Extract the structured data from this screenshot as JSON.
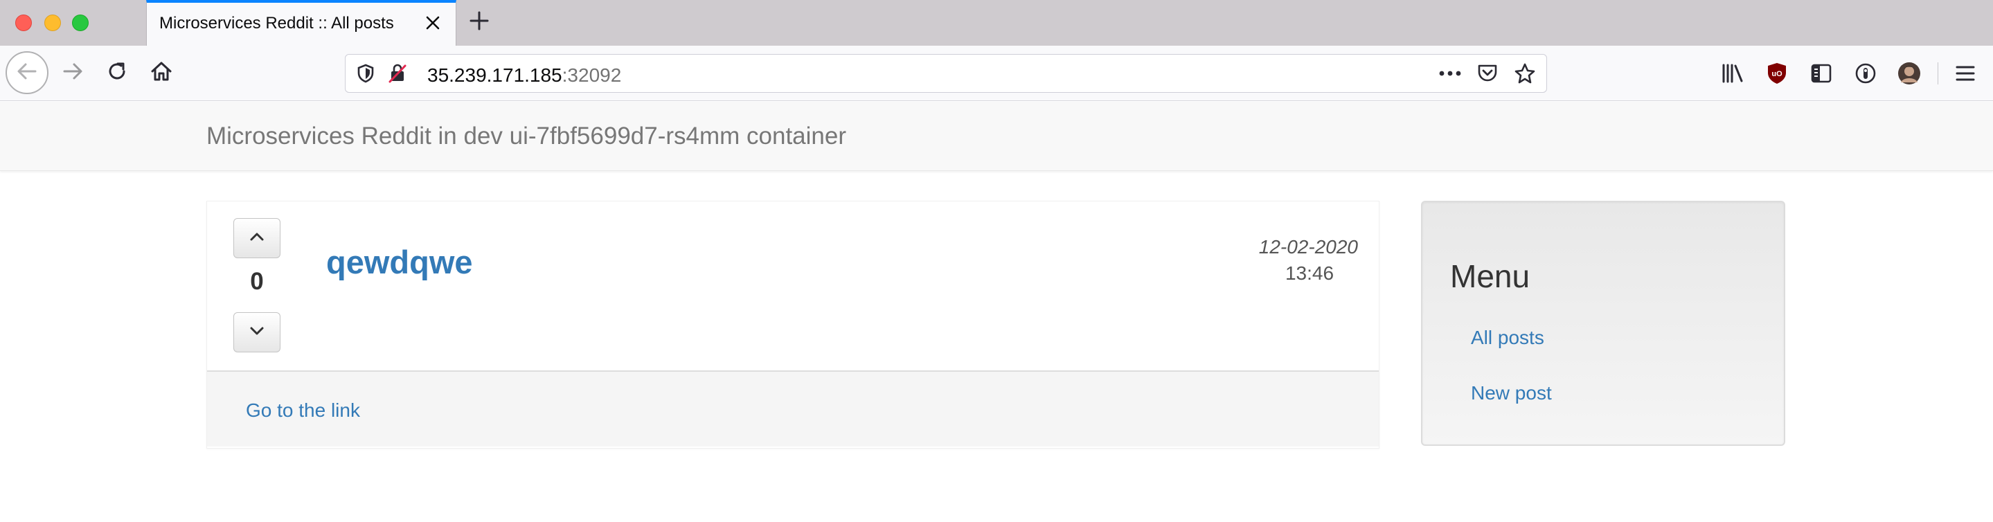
{
  "browser": {
    "tab_title": "Microservices Reddit :: All posts",
    "url_host": "35.239.171.185",
    "url_port": ":32092",
    "icons": {
      "back": "arrow-left-icon",
      "forward": "arrow-right-icon",
      "reload": "reload-icon",
      "home": "home-icon",
      "new_tab": "plus-icon",
      "close_tab": "close-icon",
      "library": "library-icon",
      "ublock": "ublock-origin-icon",
      "sidebar": "sidebar-icon",
      "extension": "extension-icon",
      "menu": "hamburger-menu-icon",
      "page_actions": "more-horizontal-icon",
      "pocket": "pocket-icon",
      "bookmark": "star-icon"
    }
  },
  "header": {
    "brand": "Microservices Reddit in dev ui-7fbf5699d7-rs4mm container"
  },
  "post": {
    "votes": "0",
    "title": "qewdqwe",
    "date": "12-02-2020",
    "time": "13:46",
    "link_label": "Go to the link"
  },
  "menu": {
    "title": "Menu",
    "items": [
      {
        "label": "All posts"
      },
      {
        "label": "New post"
      }
    ]
  },
  "colors": {
    "link": "#337ab7",
    "brand_text": "#777777",
    "tab_accent": "#0a84ff"
  }
}
